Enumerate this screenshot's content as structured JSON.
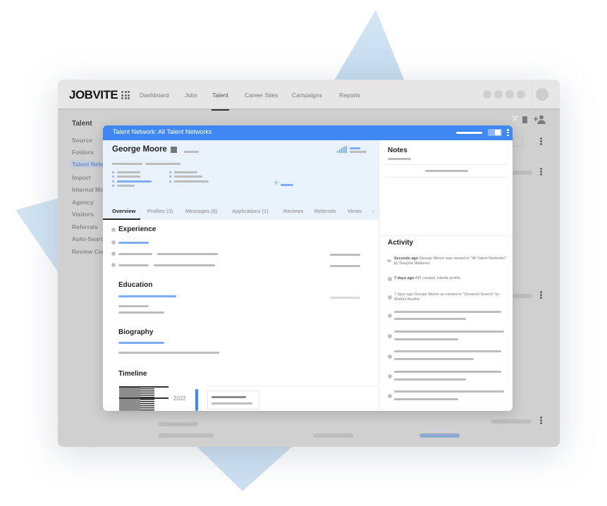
{
  "app": {
    "logo": "JOBVITE",
    "nav": [
      {
        "label": "Dashboard",
        "active": false
      },
      {
        "label": "Jobs",
        "active": false
      },
      {
        "label": "Talent",
        "active": true
      },
      {
        "label": "Career Sites",
        "active": false
      },
      {
        "label": "Campaigns",
        "active": false
      },
      {
        "label": "Reports",
        "active": false
      }
    ],
    "icons": {
      "apps": "grid-icon",
      "close": "×",
      "add_user": "add-user-icon"
    }
  },
  "sidebar": {
    "title": "Talent",
    "items": [
      {
        "label": "Source",
        "active": false
      },
      {
        "label": "Folders",
        "active": false
      },
      {
        "label": "Talent Netw",
        "active": true
      },
      {
        "label": "Import",
        "active": false
      },
      {
        "label": "Internal Mo",
        "active": false
      },
      {
        "label": "Agency",
        "active": false
      },
      {
        "label": "Visitors",
        "active": false
      },
      {
        "label": "Referrals",
        "active": false
      },
      {
        "label": "Auto-Searc",
        "active": false
      },
      {
        "label": "Review Cer",
        "active": false
      }
    ]
  },
  "modal": {
    "title": "Talent Network: All Talent Networks",
    "candidate": {
      "name": "George Moore"
    },
    "add_symbol": "+",
    "tabs": [
      {
        "label": "Overview",
        "active": true
      },
      {
        "label": "Profiles (3)",
        "active": false
      },
      {
        "label": "Messages (8)",
        "active": false
      },
      {
        "label": "Applications (1)",
        "active": false
      },
      {
        "label": "Reviews",
        "active": false
      },
      {
        "label": "Referrals",
        "active": false
      },
      {
        "label": "Views",
        "active": false
      }
    ],
    "tabs_more": "›",
    "sections": {
      "experience": "Experience",
      "education": "Education",
      "biography": "Biography",
      "timeline": "Timeline"
    },
    "timeline": {
      "year": "2022"
    },
    "notes": {
      "title": "Notes"
    },
    "activity": {
      "title": "Activity",
      "items": [
        {
          "when": "Seconds ago",
          "text": "George Moore was viewed in \"All Talent Networks\" by Dwayne Mathews",
          "when_bold": true
        },
        {
          "when": "7 days ago",
          "text": "API created Jobvite profile",
          "when_bold": true
        },
        {
          "when": "7 days ago",
          "text": "George Moore as viewed in \"Unsaved Search\" by Andres Booker",
          "when_bold": false
        }
      ]
    }
  },
  "colors": {
    "accent": "#3f88f4",
    "profile_bg": "#e9f1fb",
    "skeleton": "#bcbcbc",
    "skeleton_blue": "#7eacf5",
    "backdrop_shape": "#cfe2f3"
  }
}
